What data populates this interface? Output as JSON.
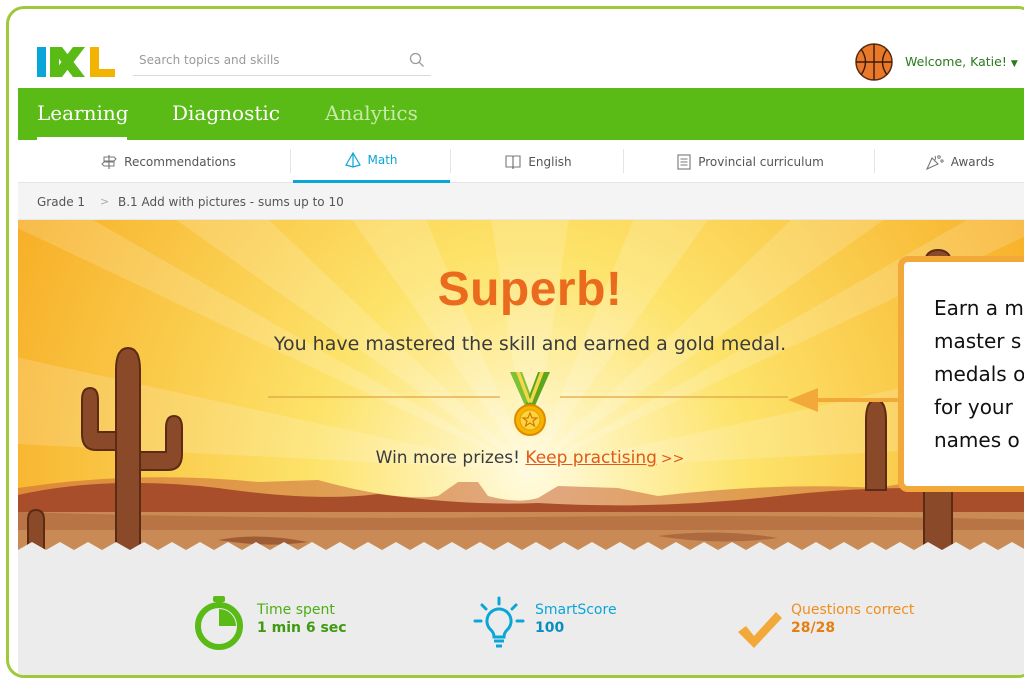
{
  "header": {
    "logo_text": "IXL",
    "search_placeholder": "Search topics and skills",
    "welcome_text": "Welcome, Katie!"
  },
  "main_nav": {
    "items": [
      {
        "label": "Learning"
      },
      {
        "label": "Diagnostic"
      },
      {
        "label": "Analytics"
      }
    ]
  },
  "sub_nav": {
    "items": [
      {
        "label": "Recommendations"
      },
      {
        "label": "Math"
      },
      {
        "label": "English"
      },
      {
        "label": "Provincial curriculum"
      },
      {
        "label": "Awards"
      }
    ]
  },
  "breadcrumb": {
    "grade": "Grade 1",
    "separator": ">",
    "skill": "B.1 Add with pictures - sums up to 10"
  },
  "hero": {
    "headline": "Superb!",
    "message": "You have mastered the skill and earned a gold medal.",
    "prompt_text": "Win more prizes!",
    "link_text": "Keep practising",
    "link_arrows": ">>"
  },
  "tooltip": {
    "lines": [
      "Earn a m",
      "master s",
      "medals o",
      "for your",
      "names o"
    ]
  },
  "stats": {
    "time_label": "Time spent",
    "time_value": "1 min 6 sec",
    "smartscore_label": "SmartScore",
    "smartscore_value": "100",
    "correct_label": "Questions correct",
    "correct_value": "28/28"
  },
  "colors": {
    "green": "#5aba16",
    "orange": "#ea6a1e",
    "blue": "#0aa6d8",
    "frame": "#9dc93b"
  }
}
